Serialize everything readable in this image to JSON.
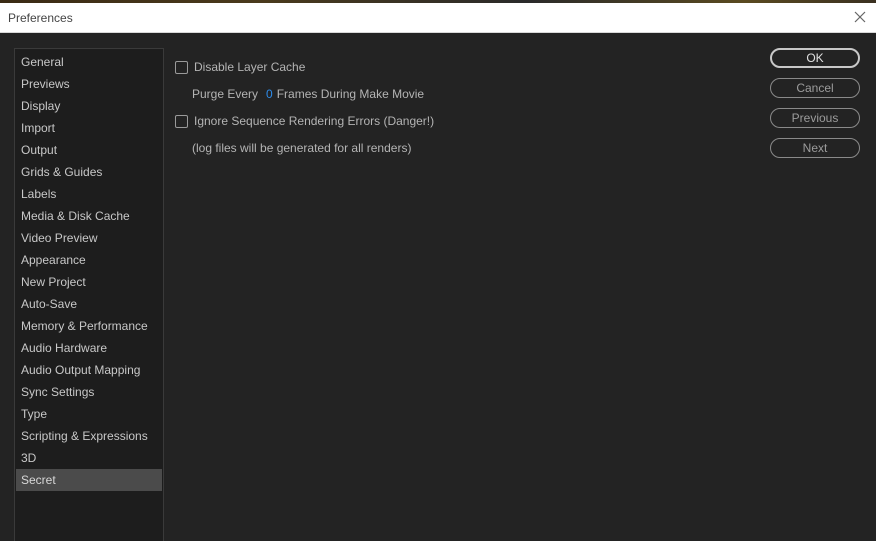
{
  "window": {
    "title": "Preferences"
  },
  "sidebar": {
    "items": [
      {
        "label": "General"
      },
      {
        "label": "Previews"
      },
      {
        "label": "Display"
      },
      {
        "label": "Import"
      },
      {
        "label": "Output"
      },
      {
        "label": "Grids & Guides"
      },
      {
        "label": "Labels"
      },
      {
        "label": "Media & Disk Cache"
      },
      {
        "label": "Video Preview"
      },
      {
        "label": "Appearance"
      },
      {
        "label": "New Project"
      },
      {
        "label": "Auto-Save"
      },
      {
        "label": "Memory & Performance"
      },
      {
        "label": "Audio Hardware"
      },
      {
        "label": "Audio Output Mapping"
      },
      {
        "label": "Sync Settings"
      },
      {
        "label": "Type"
      },
      {
        "label": "Scripting & Expressions"
      },
      {
        "label": "3D"
      },
      {
        "label": "Secret",
        "selected": true
      }
    ]
  },
  "secret": {
    "disable_layer_cache": {
      "label": "Disable Layer Cache",
      "checked": false
    },
    "purge_every": {
      "prefix": "Purge Every",
      "value": "0",
      "suffix": "Frames During Make Movie"
    },
    "ignore_errors": {
      "label": "Ignore Sequence Rendering Errors (Danger!)",
      "checked": false
    },
    "log_note": "(log files will be generated for all renders)"
  },
  "buttons": {
    "ok": "OK",
    "cancel": "Cancel",
    "previous": "Previous",
    "next": "Next"
  },
  "colors": {
    "background": "#232323",
    "sidebar_bg": "#1d1d1d",
    "selected_item": "#4b4b4b",
    "accent_value": "#2d8ceb"
  }
}
